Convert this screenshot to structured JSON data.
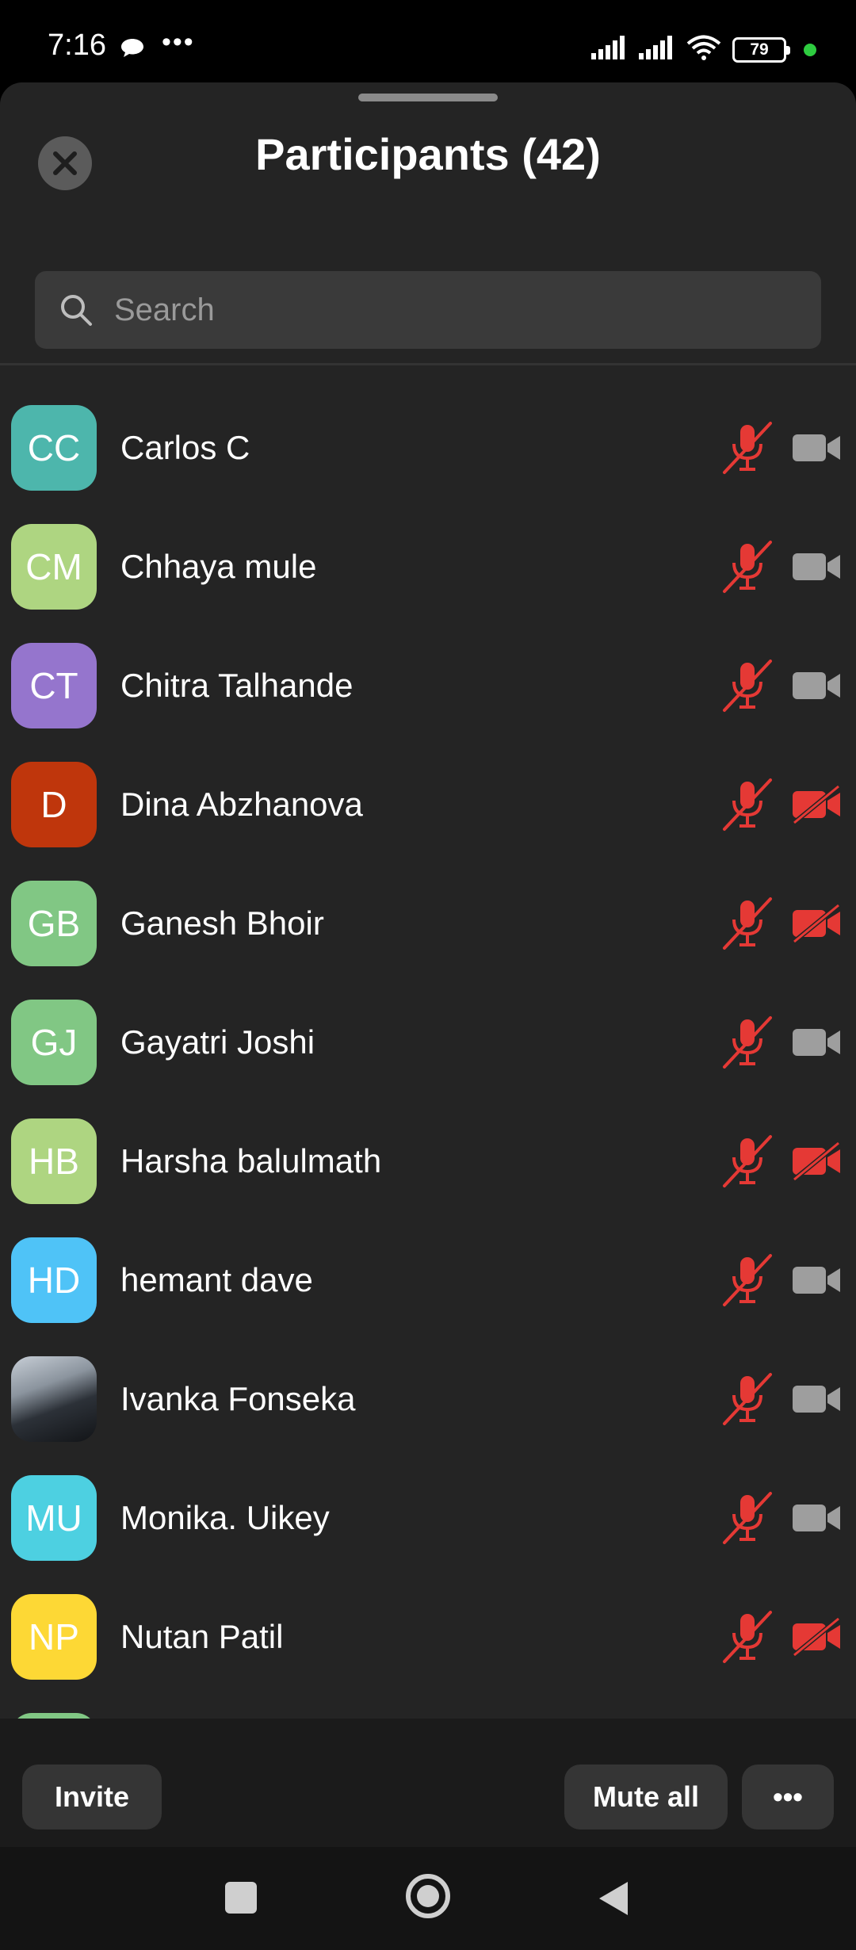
{
  "status_bar": {
    "time": "7:16",
    "battery": "79"
  },
  "header": {
    "title": "Participants (42)"
  },
  "search": {
    "placeholder": "Search"
  },
  "participants": [
    {
      "initials": "CC",
      "name": "Carlos C",
      "avatar_color": "#4db6ac",
      "mic": "muted",
      "camera": "off"
    },
    {
      "initials": "CM",
      "name": "Chhaya mule",
      "avatar_color": "#aed581",
      "mic": "muted",
      "camera": "off"
    },
    {
      "initials": "CT",
      "name": "Chitra Talhande",
      "avatar_color": "#9575cd",
      "mic": "muted",
      "camera": "off"
    },
    {
      "initials": "D",
      "name": "Dina Abzhanova",
      "avatar_color": "#bf360c",
      "mic": "muted",
      "camera": "disabled"
    },
    {
      "initials": "GB",
      "name": "Ganesh Bhoir",
      "avatar_color": "#81c784",
      "mic": "muted",
      "camera": "disabled"
    },
    {
      "initials": "GJ",
      "name": "Gayatri Joshi",
      "avatar_color": "#81c784",
      "mic": "muted",
      "camera": "off"
    },
    {
      "initials": "HB",
      "name": "Harsha balulmath",
      "avatar_color": "#aed581",
      "mic": "muted",
      "camera": "disabled"
    },
    {
      "initials": "HD",
      "name": "hemant dave",
      "avatar_color": "#4fc3f7",
      "mic": "muted",
      "camera": "off"
    },
    {
      "initials": "",
      "name": "Ivanka Fonseka",
      "avatar_color": "photo",
      "mic": "muted",
      "camera": "off"
    },
    {
      "initials": "MU",
      "name": "Monika. Uikey",
      "avatar_color": "#4dd0e1",
      "mic": "muted",
      "camera": "off"
    },
    {
      "initials": "NP",
      "name": "Nutan Patil",
      "avatar_color": "#fdd835",
      "mic": "muted",
      "camera": "disabled"
    },
    {
      "initials": "",
      "name": "",
      "avatar_color": "#81c784",
      "mic": "muted",
      "camera": "off"
    }
  ],
  "actions": {
    "invite": "Invite",
    "mute_all": "Mute all",
    "more": "•••"
  },
  "colors": {
    "muted_red": "#e53935",
    "camera_gray": "#9e9e9e",
    "sheet_bg": "#242424"
  }
}
